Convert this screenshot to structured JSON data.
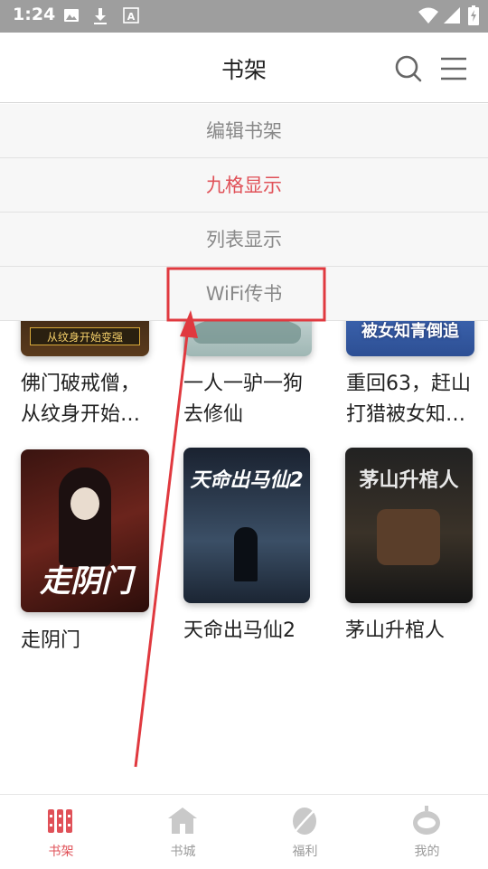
{
  "status_bar": {
    "time": "1:24",
    "icons": [
      "image-icon",
      "download-icon",
      "font-icon",
      "wifi-icon",
      "signal-icon",
      "battery-icon"
    ]
  },
  "header": {
    "title": "书架",
    "search_icon": "search-icon",
    "menu_icon": "menu-icon"
  },
  "dropdown_menu": {
    "items": [
      {
        "label": "编辑书架",
        "selected": false
      },
      {
        "label": "九格显示",
        "selected": true
      },
      {
        "label": "列表显示",
        "selected": false
      },
      {
        "label": "WiFi传书",
        "selected": false
      }
    ],
    "accent_color": "#e05158"
  },
  "books": [
    {
      "title_line1": "佛门破戒僧，",
      "title_line2": "从纹身开始…",
      "cover_text": "从纹身开始变强"
    },
    {
      "title_line1": "一人一驴一狗",
      "title_line2": "去修仙",
      "cover_text": ""
    },
    {
      "title_line1": "重回63，赶山",
      "title_line2": "打猎被女知…",
      "cover_text": "被女知青倒追"
    },
    {
      "title_line1": "走阴门",
      "title_line2": "",
      "cover_text": "走阴门"
    },
    {
      "title_line1": "天命出马仙2",
      "title_line2": "",
      "cover_text": "天命出马仙2"
    },
    {
      "title_line1": "茅山升棺人",
      "title_line2": "",
      "cover_text": "茅山升棺人"
    }
  ],
  "annotation": {
    "color": "#e0393f"
  },
  "tab_bar": {
    "tabs": [
      {
        "label": "书架",
        "icon": "bookshelf-icon",
        "active": true
      },
      {
        "label": "书城",
        "icon": "bookstore-icon",
        "active": false
      },
      {
        "label": "福利",
        "icon": "welfare-icon",
        "active": false
      },
      {
        "label": "我的",
        "icon": "profile-icon",
        "active": false
      }
    ]
  }
}
